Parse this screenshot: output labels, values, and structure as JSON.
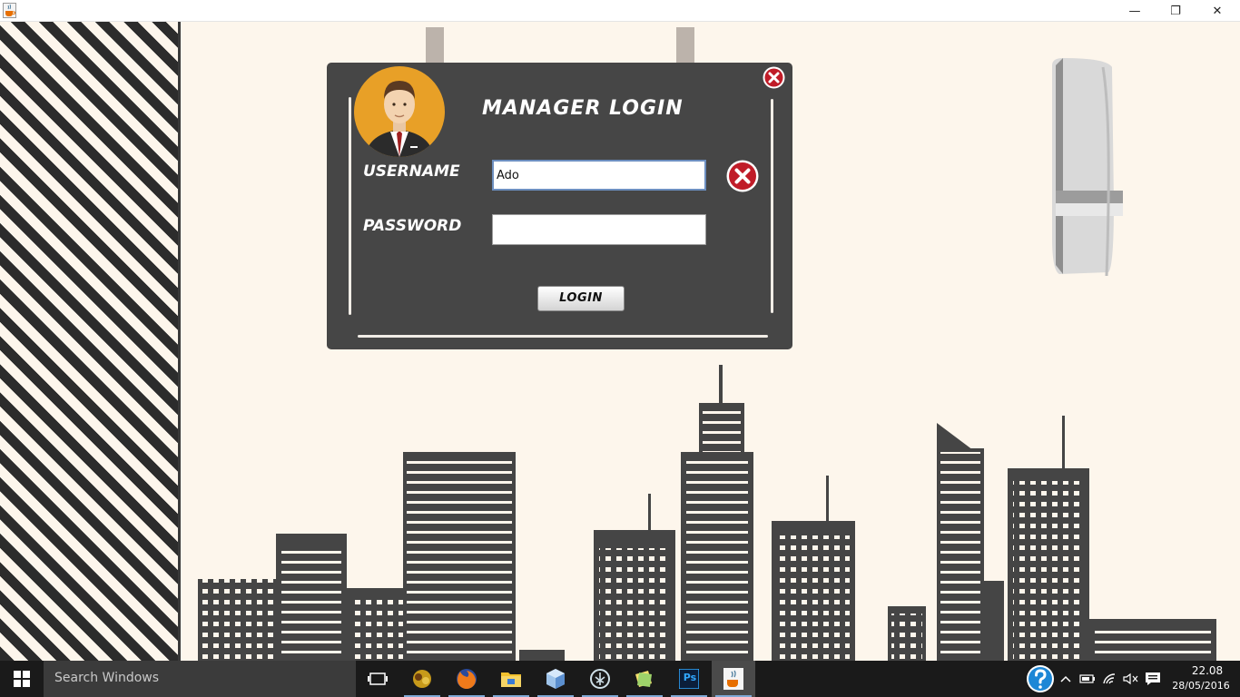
{
  "window": {
    "minimize_glyph": "—",
    "maximize_glyph": "❐",
    "close_glyph": "✕"
  },
  "login": {
    "title": "MANAGER LOGIN",
    "username_label": "USERNAME",
    "password_label": "PASSWORD",
    "username_value": "Ado",
    "password_value": "",
    "login_button": "LOGIN"
  },
  "taskbar": {
    "search_placeholder": "Search Windows",
    "apps": [
      "task-view",
      "game-app",
      "firefox",
      "file-explorer",
      "virtualbox",
      "anaconda-app",
      "sticky-notes",
      "photoshop",
      "java"
    ],
    "photoshop_label": "Ps",
    "clock_time": "22.08",
    "clock_date": "28/05/2016"
  },
  "colors": {
    "panel": "#464646",
    "background": "#fdf6ec",
    "buildings": "#454545",
    "accent_red": "#c01c28",
    "avatar_orange": "#e8a027"
  },
  "icons": {
    "app": "java-cup-icon",
    "clear": "clear-x-icon",
    "close": "close-x-icon",
    "avatar": "manager-avatar-icon",
    "start": "windows-logo-icon",
    "help": "help-question-icon"
  }
}
